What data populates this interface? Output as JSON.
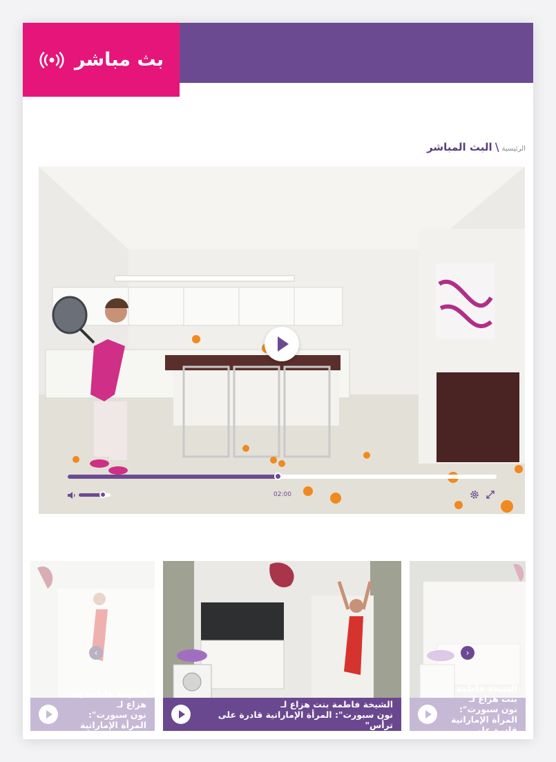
{
  "header": {
    "live_title": "بث مباشر",
    "live_icon": "broadcast-icon",
    "brand_color": "#6c4a92",
    "accent_color": "#e5157a"
  },
  "breadcrumb": {
    "home": "الرئيسية",
    "separator": "\\",
    "current": "البث المباشر"
  },
  "player": {
    "time": "02:00",
    "progress_fraction": 0.49,
    "volume_fraction": 0.75,
    "icons": [
      "play-icon",
      "volume-icon",
      "settings-icon",
      "fullscreen-icon"
    ]
  },
  "thumbnails": [
    {
      "title": "الشيخة فاطمة بنت هزاع لـ\nنون سبورت\": المرأة الإماراتية قادرة على ترأس\"",
      "state": "faded"
    },
    {
      "title": "الشيخة فاطمة بنت هزاع لـ\nنون سبورت\": المرأة الإماراتية قادرة على ترأس\"",
      "state": "active"
    },
    {
      "title": "الشيخة فاطمة بنت هزاع لـ\nنون سبورت\": المرأة الإماراتية قادرة على ترأس\"",
      "state": "faded"
    }
  ],
  "carousel": {
    "prev_icon": "chevron-left-icon",
    "next_icon": "chevron-right-icon"
  }
}
